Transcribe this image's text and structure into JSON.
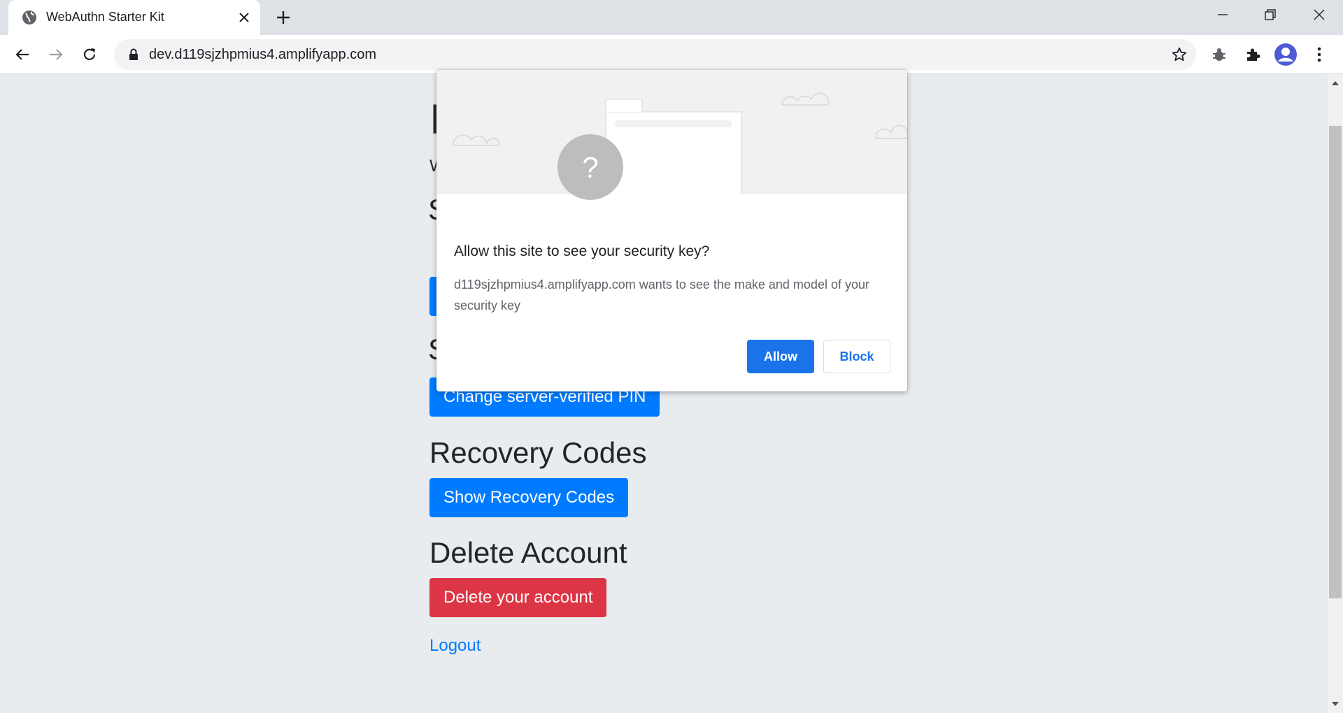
{
  "browser": {
    "tab_title": "WebAuthn Starter Kit",
    "url": "dev.d119sjzhpmius4.amplifyapp.com"
  },
  "page": {
    "sections": {
      "recovery_heading": "Recovery Codes",
      "delete_heading": "Delete Account"
    },
    "buttons": {
      "change_pin": "Change server-verified PIN",
      "show_recovery": "Show Recovery Codes",
      "delete_account": "Delete your account"
    },
    "logout_label": "Logout",
    "partial_heading_1": "I",
    "partial_text": "W",
    "partial_heading_2": "S",
    "partial_heading_3": "S"
  },
  "dialog": {
    "title": "Allow this site to see your security key?",
    "body": "d119sjzhpmius4.amplifyapp.com wants to see the make and model of your security key",
    "allow_label": "Allow",
    "block_label": "Block",
    "illustration_glyph": "?"
  },
  "colors": {
    "primary": "#007bff",
    "danger": "#dc3545",
    "chrome_blue": "#1a73e8"
  }
}
